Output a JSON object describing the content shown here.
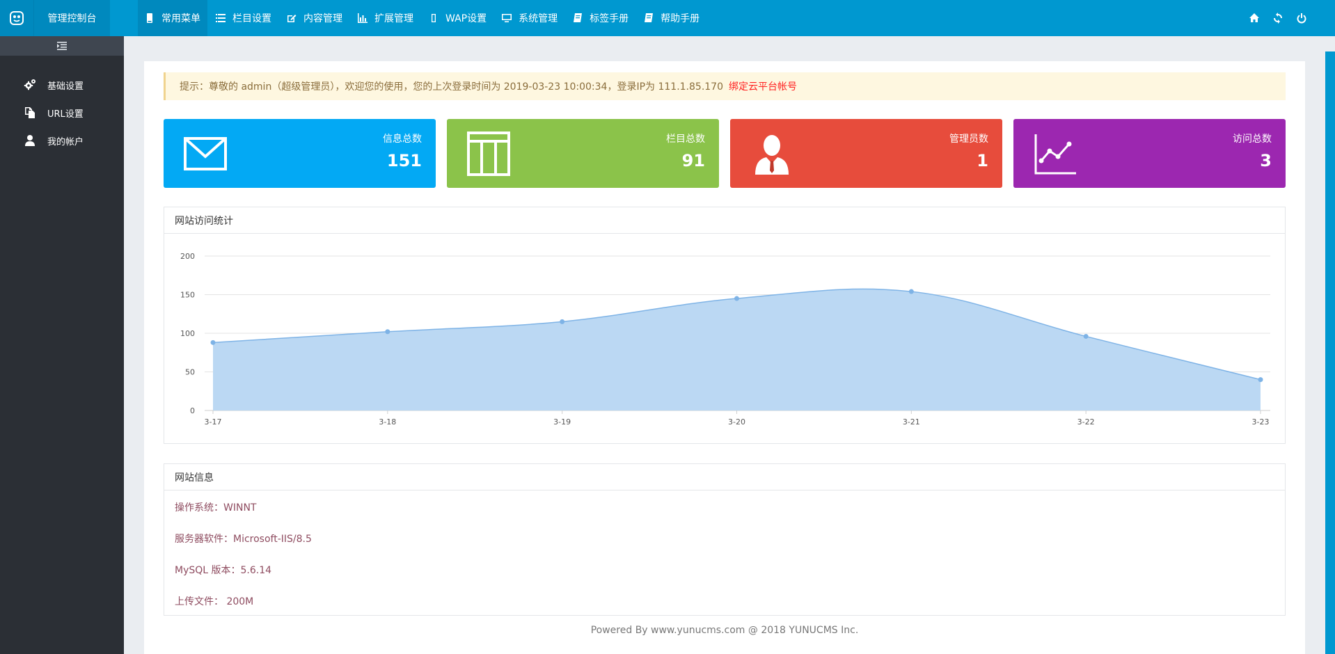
{
  "topbar": {
    "brand": "管理控制台",
    "nav": [
      {
        "label": "常用菜单",
        "icon": "phone-icon",
        "active": true
      },
      {
        "label": "栏目设置",
        "icon": "list-icon"
      },
      {
        "label": "内容管理",
        "icon": "edit-icon"
      },
      {
        "label": "扩展管理",
        "icon": "bar-chart-icon"
      },
      {
        "label": "WAP设置",
        "icon": "mobile-icon"
      },
      {
        "label": "系统管理",
        "icon": "monitor-icon"
      },
      {
        "label": "标签手册",
        "icon": "book-icon"
      },
      {
        "label": "帮助手册",
        "icon": "book-icon"
      }
    ],
    "actions": [
      "home-icon",
      "refresh-icon",
      "power-icon"
    ]
  },
  "sidebar": {
    "items": [
      {
        "label": "基础设置",
        "icon": "gears-icon"
      },
      {
        "label": "URL设置",
        "icon": "files-icon"
      },
      {
        "label": "我的帐户",
        "icon": "user-icon"
      }
    ]
  },
  "notice": {
    "text": "提示：尊敬的 admin（超级管理员），欢迎您的使用，您的上次登录时间为 2019-03-23 10:00:34，登录IP为 111.1.85.170",
    "link": "绑定云平台帐号"
  },
  "cards": [
    {
      "label": "信息总数",
      "value": "151",
      "color": "#03a9f4",
      "icon": "envelope-icon"
    },
    {
      "label": "栏目总数",
      "value": "91",
      "color": "#8bc34a",
      "icon": "columns-icon"
    },
    {
      "label": "管理员数",
      "value": "1",
      "color": "#e74c3c",
      "icon": "admin-user-icon"
    },
    {
      "label": "访问总数",
      "value": "3",
      "color": "#9c27b0",
      "icon": "line-chart-icon"
    }
  ],
  "chart_panel": {
    "title": "网站访问统计"
  },
  "chart_data": {
    "type": "area",
    "x": [
      "3-17",
      "3-18",
      "3-19",
      "3-20",
      "3-21",
      "3-22",
      "3-23"
    ],
    "series": [
      {
        "values": [
          88,
          102,
          115,
          145,
          154,
          96,
          40
        ]
      }
    ],
    "ylim": [
      0,
      200
    ],
    "yticks": [
      0,
      50,
      100,
      150,
      200
    ],
    "grid": true,
    "fill_color": "#bbd8f3",
    "line_color": "#7eb3e6"
  },
  "info_panel": {
    "title": "网站信息",
    "rows": [
      "操作系统：WINNT",
      "服务器软件：Microsoft-IIS/8.5",
      "MySQL 版本：5.6.14",
      "上传文件： 200M"
    ]
  },
  "footer": "Powered By www.yunucms.com @ 2018 YUNUCMS Inc."
}
